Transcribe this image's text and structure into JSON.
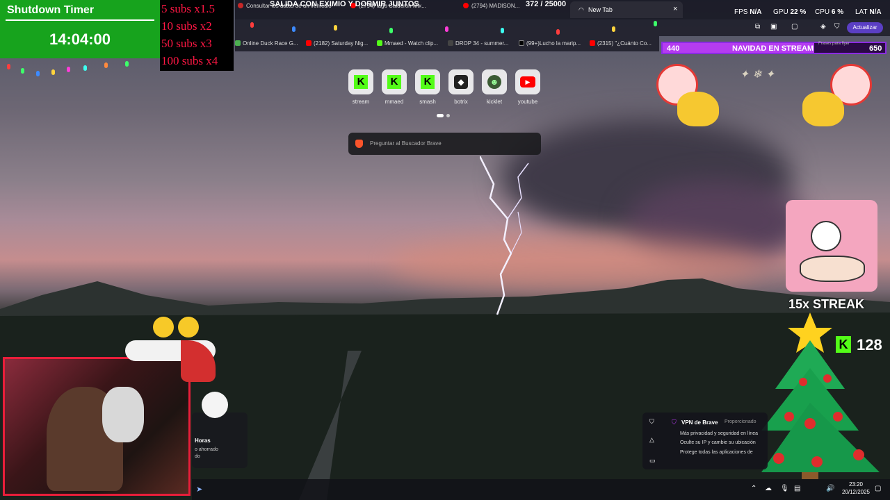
{
  "timer": {
    "title": "Shutdown Timer",
    "time": "14:04:00"
  },
  "subs": [
    "5 subs x1.5",
    "10 subs x2",
    "50 subs x3",
    "100 subs x4"
  ],
  "stream_title": "SALIDA CON EXIMIO Y DORMIR JUNTOS",
  "goal": {
    "current": "372",
    "total": "/ 25000"
  },
  "tabs": [
    {
      "label": "Consultar los datos de un vehículo"
    },
    {
      "label": "(2794) Iago Calderon Mix..."
    },
    {
      "label": "(2794) MADISON..."
    }
  ],
  "active_tab": {
    "label": "New Tab",
    "close": "×"
  },
  "stats": {
    "fps_label": "FPS",
    "fps": "N/A",
    "gpu_label": "GPU",
    "gpu": "22 %",
    "cpu_label": "CPU",
    "cpu": "6 %",
    "lat_label": "LAT",
    "lat": "N/A"
  },
  "update_button": "Actualizar",
  "bookmarks": [
    {
      "label": "Online Duck Race G...",
      "color": "#4caf50"
    },
    {
      "label": "(2182) Saturday Nig...",
      "color": "#ff0000"
    },
    {
      "label": "Mmaed - Watch clip...",
      "color": "#53fc18"
    },
    {
      "label": "DROP 34 - summer...",
      "color": "#222222"
    },
    {
      "label": "(99+)Lucho la marip...",
      "color": "#111111"
    },
    {
      "label": "(2315) \"¿Cuánto Co...",
      "color": "#ff0000"
    }
  ],
  "banner": {
    "left": "440",
    "title": "NAVIDAD EN STREAM",
    "note": "Frases para flyer",
    "right": "650",
    "progress": 0.68
  },
  "shortcuts": [
    {
      "label": "stream",
      "icon": "kick-icon"
    },
    {
      "label": "mmaed",
      "icon": "kick-icon"
    },
    {
      "label": "smash",
      "icon": "kick-icon"
    },
    {
      "label": "botrix",
      "icon": "botrix-icon"
    },
    {
      "label": "kicklet",
      "icon": "kicklet-icon"
    },
    {
      "label": "youtube",
      "icon": "youtube-icon"
    }
  ],
  "search": {
    "placeholder": "Preguntar al Buscador Brave"
  },
  "sticker": {
    "streak": "15x STREAK",
    "kick_count": "128",
    "kick_letter": "K"
  },
  "vpn": {
    "title": "VPN de Brave",
    "subtitle": "Proporcionado",
    "items": [
      "Más privacidad y seguridad en línea",
      "Oculte su IP y cambie su ubicación",
      "Protege todas las aplicaciones de"
    ]
  },
  "popup": {
    "title": "Horas",
    "line1": "o ahorrado",
    "line2": "do"
  },
  "clock": {
    "time": "23:20",
    "date": "20/12/2025"
  },
  "colors": {
    "kick": "#53fc18",
    "timer_bg": "#17a31d",
    "subs_text": "#ff1744",
    "banner": "#8b2be2",
    "youtube": "#ff0000"
  }
}
